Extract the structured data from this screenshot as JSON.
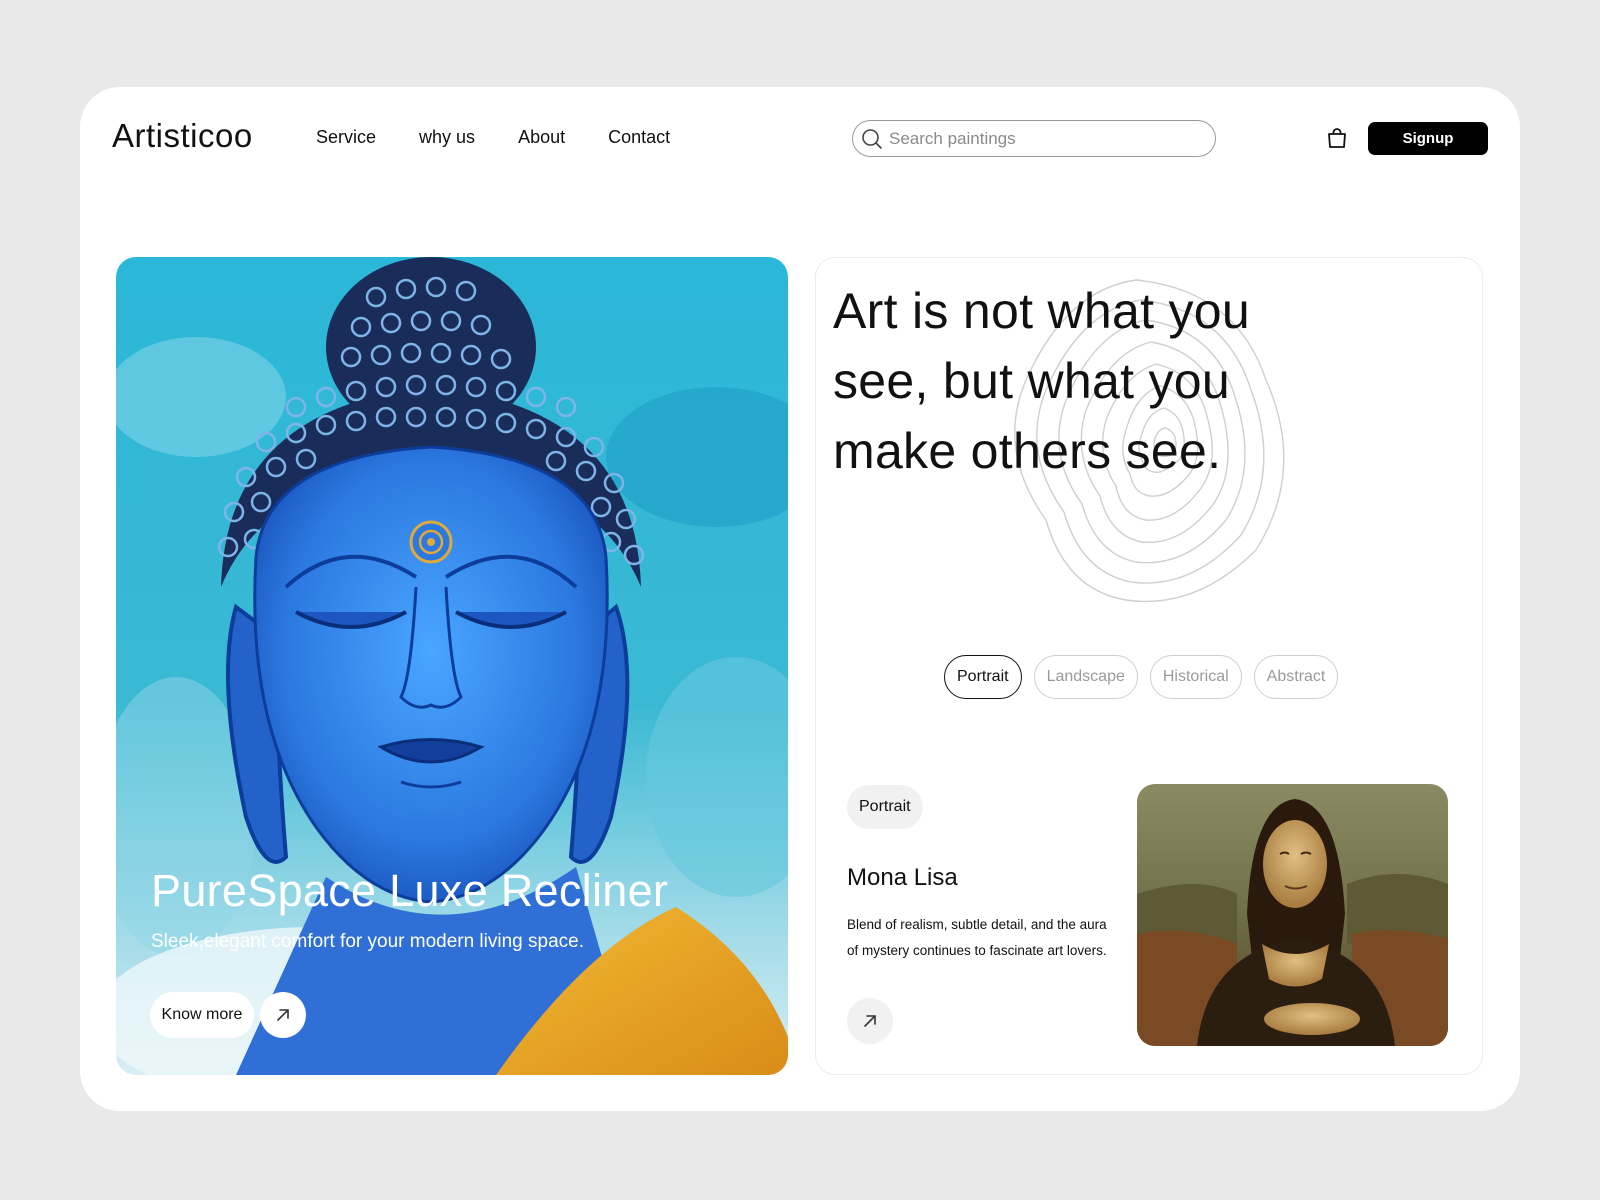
{
  "header": {
    "logo": "Artisticoo",
    "nav": [
      "Service",
      "why us",
      "About",
      "Contact"
    ],
    "search_placeholder": "Search paintings",
    "signup_label": "Signup"
  },
  "hero": {
    "title": "PureSpace Luxe Recliner",
    "subtitle": "Sleek,elegant comfort for your modern living space.",
    "cta_label": "Know more"
  },
  "panel": {
    "quote": "Art is not what you see, but what you make others see.",
    "filters": [
      {
        "label": "Portrait",
        "active": true
      },
      {
        "label": "Landscape",
        "active": false
      },
      {
        "label": "Historical",
        "active": false
      },
      {
        "label": "Abstract",
        "active": false
      }
    ],
    "featured": {
      "tag": "Portrait",
      "name": "Mona Lisa",
      "description": "Blend of realism, subtle detail, and the aura of mystery continues to fascinate art lovers."
    }
  },
  "colors": {
    "background": "#e9e9e9",
    "card": "#ffffff",
    "accent": "#000000",
    "chip_inactive": "#9a9a9a"
  },
  "icons": [
    "search-icon",
    "shopping-bag-icon",
    "arrow-up-right-icon"
  ]
}
